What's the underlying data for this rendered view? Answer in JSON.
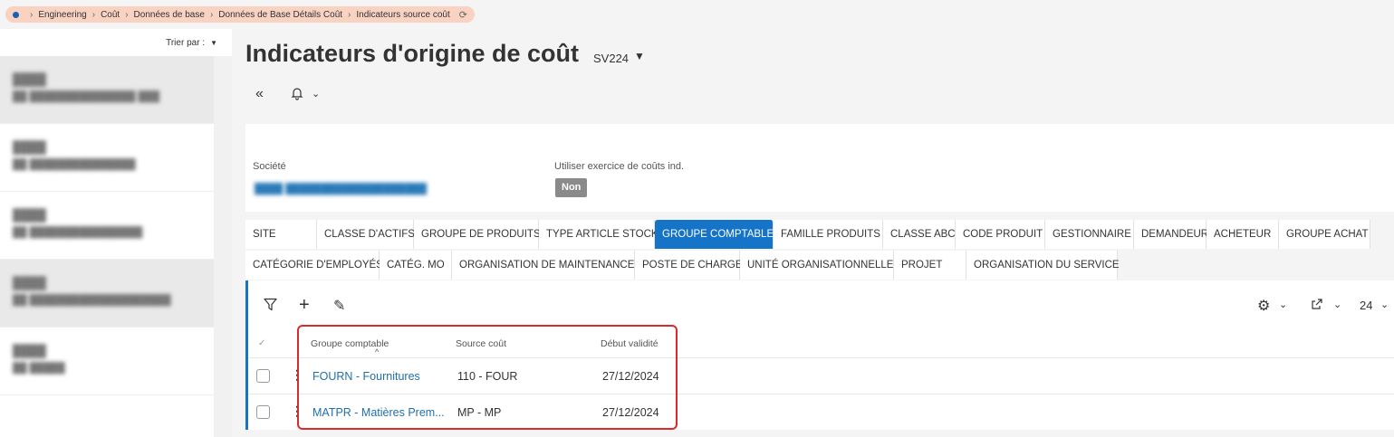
{
  "breadcrumb": {
    "items": [
      "Engineering",
      "Coût",
      "Données de base",
      "Données de Base Détails Coût",
      "Indicateurs source coût"
    ]
  },
  "sidebar": {
    "sort_label": "Trier par :"
  },
  "header": {
    "title": "Indicateurs d'origine de coût",
    "version": "SV224"
  },
  "form": {
    "societe_label": "Société",
    "exercice_label": "Utiliser exercice de coûts ind.",
    "exercice_value": "Non"
  },
  "tabs": {
    "row1": [
      "SITE",
      "CLASSE D'ACTIFS",
      "GROUPE DE PRODUITS",
      "TYPE ARTICLE STOCK",
      "GROUPE COMPTABLE",
      "FAMILLE PRODUITS",
      "CLASSE ABC",
      "CODE PRODUIT",
      "GESTIONNAIRE",
      "DEMANDEUR",
      "ACHETEUR",
      "GROUPE ACHAT"
    ],
    "row2": [
      "CATÉGORIE D'EMPLOYÉS",
      "CATÉG. MO",
      "ORGANISATION DE MAINTENANCE",
      "POSTE DE CHARGE",
      "UNITÉ ORGANISATIONNELLE",
      "PROJET",
      "ORGANISATION DU SERVICE"
    ],
    "active": "GROUPE COMPTABLE"
  },
  "grid": {
    "page_size": "24",
    "columns": [
      "Groupe comptable",
      "Source coût",
      "Début validité"
    ],
    "rows": [
      {
        "groupe": "FOURN - Fournitures",
        "source": "110 - FOUR",
        "debut": "27/12/2024"
      },
      {
        "groupe": "MATPR - Matières Prem...",
        "source": "MP - MP",
        "debut": "27/12/2024"
      }
    ]
  },
  "colors": {
    "accent": "#1674c8",
    "link": "#1f6fae",
    "breadcrumb_bg": "#f9d2c2",
    "highlight_box": "#d92b2b"
  }
}
